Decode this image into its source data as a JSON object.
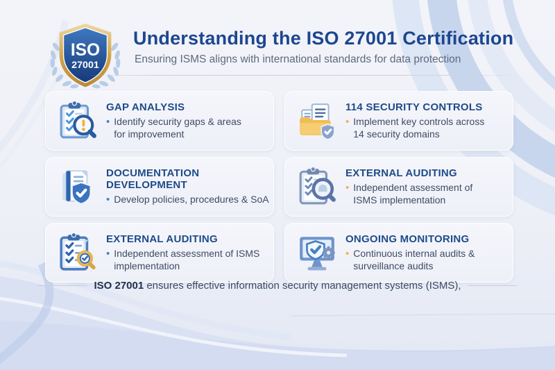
{
  "bullet_glyph": "•",
  "header": {
    "badge_line1": "ISO",
    "badge_line2": "27001",
    "title": "Understanding the ISO 27001 Certification",
    "subtitle": "Ensuring ISMS aligns with international standards for data protection"
  },
  "cards": [
    {
      "icon": "clipboard-magnifier-alert-icon",
      "title": "GAP ANALYSIS",
      "description": "Identify security gaps & areas for improvement",
      "bullet_style": "color:#4a7fc1"
    },
    {
      "icon": "folder-documents-shield-icon",
      "title": "114 SECURITY CONTROLS",
      "description": "Implement key controls across 14 security domains",
      "bullet_style": "color:#e9b44c"
    },
    {
      "icon": "documents-shield-icon",
      "title": "DOCUMENTATION DEVELOPMENT",
      "description": "Develop policies, procedures & SoA",
      "bullet_style": "color:#4a7fc1"
    },
    {
      "icon": "clipboard-magnifier-icon",
      "title": "EXTERNAL AUDITING",
      "description": "Independent assessment of ISMS implementation",
      "bullet_style": "color:#e9b44c"
    },
    {
      "icon": "clipboard-magnifier-check-icon",
      "title": "EXTERNAL AUDITING",
      "description": "Independent assessment of ISMS implementation",
      "bullet_style": "color:#4a7fc1"
    },
    {
      "icon": "monitor-shield-gear-icon",
      "title": "ONGOING MONITORING",
      "description": "Continuous internal audits & surveillance audits",
      "bullet_style": "color:#e9b44c"
    }
  ],
  "footer": {
    "bold": "ISO 27001",
    "rest": " ensures effective information security management systems (ISMS),"
  },
  "colors": {
    "title_navy": "#1c4690",
    "subtitle_gray": "#5c6a80",
    "card_title_blue": "#1e4b8a",
    "body_text": "#3e4b64",
    "bullet_blue": "#4a7fc1",
    "bullet_gold": "#e9b44c",
    "badge_shield_blue": "#1f4c92",
    "badge_gold": "#d3a44c",
    "laurel_blue": "#b7cde8",
    "card_bg": "#f1f3f9",
    "page_bg": "#eef0f7",
    "wave_blue": "#c9d7ee"
  }
}
